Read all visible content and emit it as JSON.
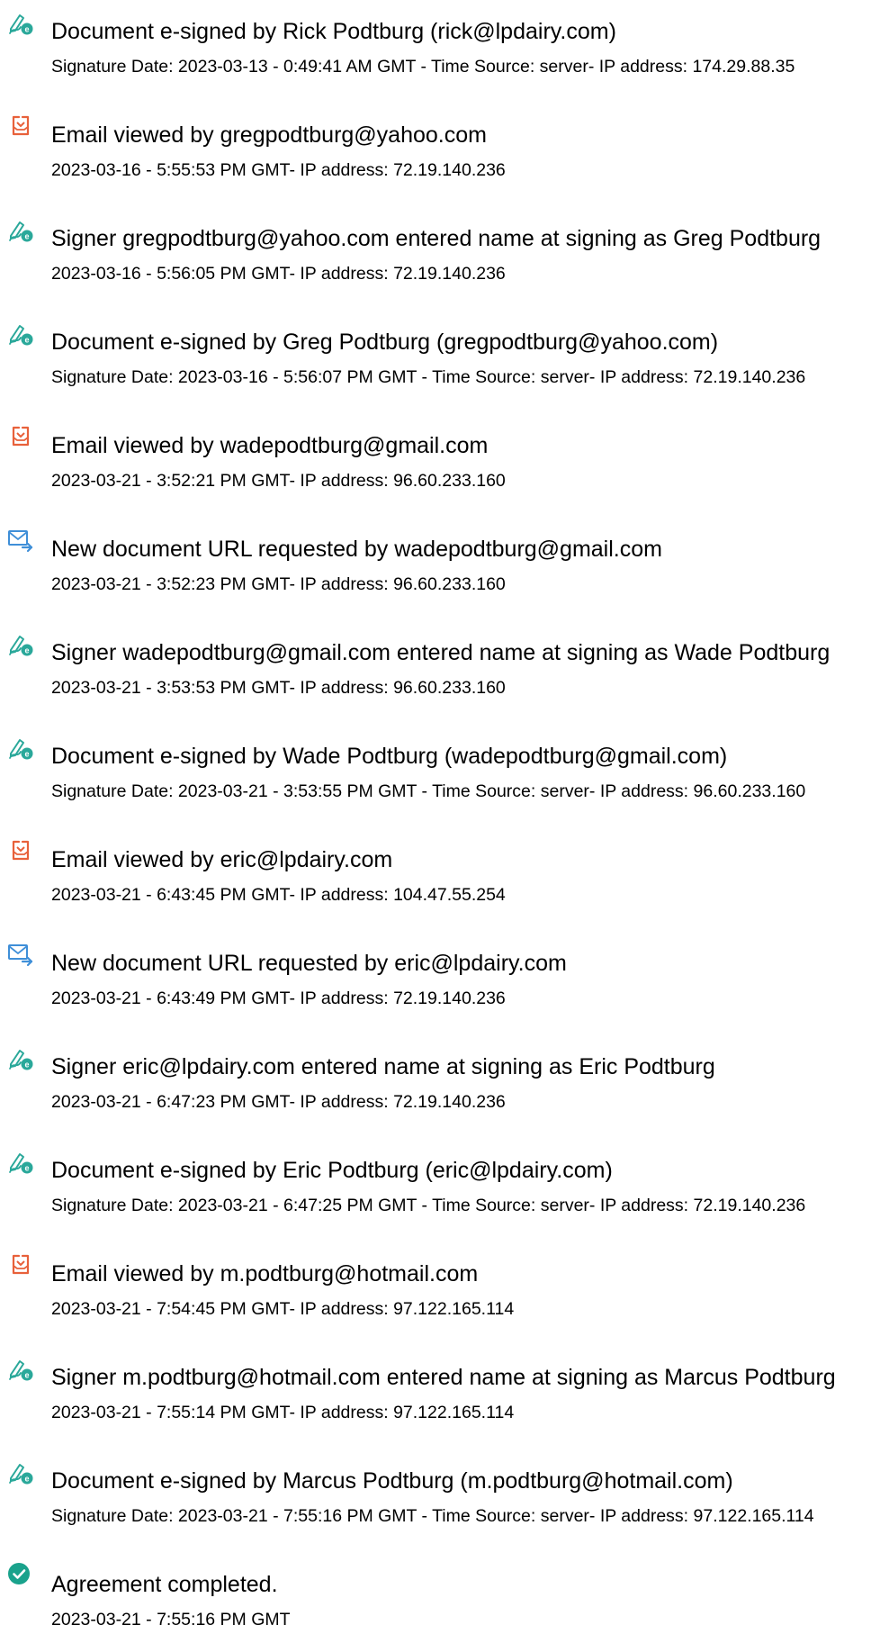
{
  "events": [
    {
      "icon": "esign-icon",
      "title": "Document e-signed by Rick Podtburg (rick@lpdairy.com)",
      "detail": "Signature Date: 2023-03-13 - 0:49:41 AM GMT - Time Source: server- IP address: 174.29.88.35"
    },
    {
      "icon": "email-viewed-icon",
      "title": "Email viewed by gregpodtburg@yahoo.com",
      "detail": "2023-03-16 - 5:55:53 PM GMT- IP address: 72.19.140.236"
    },
    {
      "icon": "esign-icon",
      "title": "Signer gregpodtburg@yahoo.com entered name at signing as Greg Podtburg",
      "detail": "2023-03-16 - 5:56:05 PM GMT- IP address: 72.19.140.236"
    },
    {
      "icon": "esign-icon",
      "title": "Document e-signed by Greg Podtburg (gregpodtburg@yahoo.com)",
      "detail": "Signature Date: 2023-03-16 - 5:56:07 PM GMT - Time Source: server- IP address: 72.19.140.236"
    },
    {
      "icon": "email-viewed-icon",
      "title": "Email viewed by wadepodtburg@gmail.com",
      "detail": "2023-03-21 - 3:52:21 PM GMT- IP address: 96.60.233.160"
    },
    {
      "icon": "url-request-icon",
      "title": "New document URL requested by wadepodtburg@gmail.com",
      "detail": "2023-03-21 - 3:52:23 PM GMT- IP address: 96.60.233.160"
    },
    {
      "icon": "esign-icon",
      "title": "Signer wadepodtburg@gmail.com entered name at signing as Wade Podtburg",
      "detail": "2023-03-21 - 3:53:53 PM GMT- IP address: 96.60.233.160"
    },
    {
      "icon": "esign-icon",
      "title": "Document e-signed by Wade Podtburg (wadepodtburg@gmail.com)",
      "detail": "Signature Date: 2023-03-21 - 3:53:55 PM GMT - Time Source: server- IP address: 96.60.233.160"
    },
    {
      "icon": "email-viewed-icon",
      "title": "Email viewed by eric@lpdairy.com",
      "detail": "2023-03-21 - 6:43:45 PM GMT- IP address: 104.47.55.254"
    },
    {
      "icon": "url-request-icon",
      "title": "New document URL requested by eric@lpdairy.com",
      "detail": "2023-03-21 - 6:43:49 PM GMT- IP address: 72.19.140.236"
    },
    {
      "icon": "esign-icon",
      "title": "Signer eric@lpdairy.com entered name at signing as Eric Podtburg",
      "detail": "2023-03-21 - 6:47:23 PM GMT- IP address: 72.19.140.236"
    },
    {
      "icon": "esign-icon",
      "title": "Document e-signed by Eric Podtburg (eric@lpdairy.com)",
      "detail": "Signature Date: 2023-03-21 - 6:47:25 PM GMT - Time Source: server- IP address: 72.19.140.236"
    },
    {
      "icon": "email-viewed-icon",
      "title": "Email viewed by m.podtburg@hotmail.com",
      "detail": "2023-03-21 - 7:54:45 PM GMT- IP address: 97.122.165.114"
    },
    {
      "icon": "esign-icon",
      "title": "Signer m.podtburg@hotmail.com entered name at signing as Marcus Podtburg",
      "detail": "2023-03-21 - 7:55:14 PM GMT- IP address: 97.122.165.114"
    },
    {
      "icon": "esign-icon",
      "title": "Document e-signed by Marcus Podtburg (m.podtburg@hotmail.com)",
      "detail": "Signature Date: 2023-03-21 - 7:55:16 PM GMT - Time Source: server- IP address: 97.122.165.114"
    },
    {
      "icon": "checkmark-icon",
      "title": "Agreement completed.",
      "detail": "2023-03-21 - 7:55:16 PM GMT"
    }
  ],
  "colors": {
    "esign_teal": "#2aa89a",
    "email_orange": "#e8613b",
    "url_blue": "#3f8fd8",
    "complete_green": "#1aa28c"
  }
}
